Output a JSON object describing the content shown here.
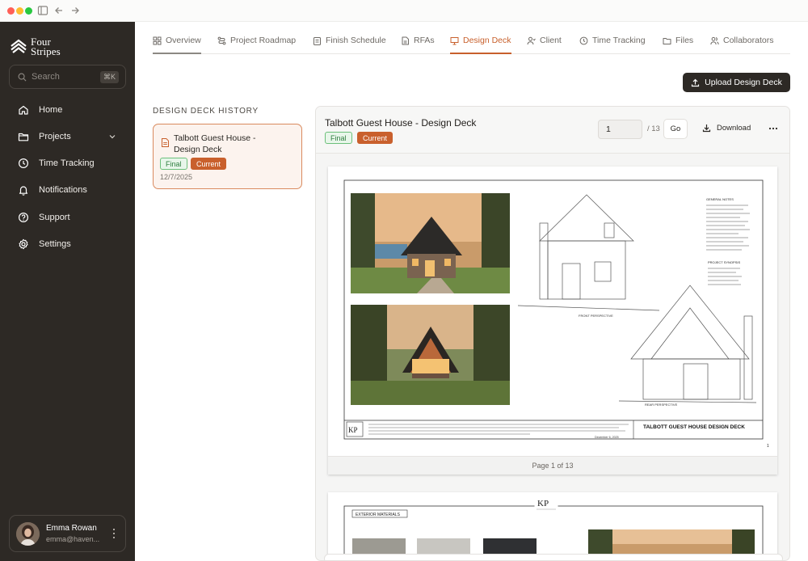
{
  "window": {
    "colors": {
      "close": "#ff5f57",
      "minimize": "#febc2e",
      "zoom": "#28c840"
    }
  },
  "brand": {
    "name_line1": "Four",
    "name_line2": "Stripes"
  },
  "search": {
    "placeholder": "Search",
    "shortcut": "⌘K"
  },
  "nav": {
    "items": [
      {
        "label": "Home",
        "icon": "home-icon"
      },
      {
        "label": "Projects",
        "icon": "folder-icon"
      },
      {
        "label": "Time Tracking",
        "icon": "clock-icon"
      },
      {
        "label": "Notifications",
        "icon": "bell-icon"
      },
      {
        "label": "Support",
        "icon": "help-icon"
      },
      {
        "label": "Settings",
        "icon": "gear-icon"
      }
    ]
  },
  "user": {
    "name": "Emma Rowan",
    "email": "emma@haven..."
  },
  "tabs": [
    {
      "label": "Overview",
      "icon": "grid-icon"
    },
    {
      "label": "Project Roadmap",
      "icon": "route-icon"
    },
    {
      "label": "Finish Schedule",
      "icon": "clipboard-icon"
    },
    {
      "label": "RFAs",
      "icon": "document-icon"
    },
    {
      "label": "Design Deck",
      "icon": "presentation-icon",
      "active": true
    },
    {
      "label": "Client",
      "icon": "user-icon"
    },
    {
      "label": "Time Tracking",
      "icon": "clock-icon"
    },
    {
      "label": "Files",
      "icon": "folder-icon"
    },
    {
      "label": "Collaborators",
      "icon": "users-icon"
    }
  ],
  "actions": {
    "upload_label": "Upload Design Deck"
  },
  "history": {
    "title": "DESIGN DECK HISTORY",
    "items": [
      {
        "title": "Talbott Guest House - Design Deck",
        "badge_final": "Final",
        "badge_current": "Current",
        "date": "12/7/2025"
      }
    ]
  },
  "viewer": {
    "title": "Talbott Guest House - Design Deck",
    "badge_final": "Final",
    "badge_current": "Current",
    "page_value": "1",
    "page_total": "/ 13",
    "go_label": "Go",
    "download_label": "Download",
    "page_label": "Page 1 of 13",
    "sheet": {
      "title": "TALBOTT GUEST HOUSE DESIGN DECK",
      "logo": "KP",
      "front_caption": "FRONT PERSPECTIVE",
      "rear_caption": "REAR PERSPECTIVE",
      "notes_title": "GENERAL NOTES",
      "synopsis_title": "PROJECT SYNOPSIS",
      "date": "December 6, 2025",
      "sheet_number": "1",
      "page2_section": "EXTERIOR MATERIALS"
    }
  },
  "colors": {
    "accent": "#c8602c",
    "sidebar": "#2d2925",
    "final_green": "#2d7d3e"
  }
}
